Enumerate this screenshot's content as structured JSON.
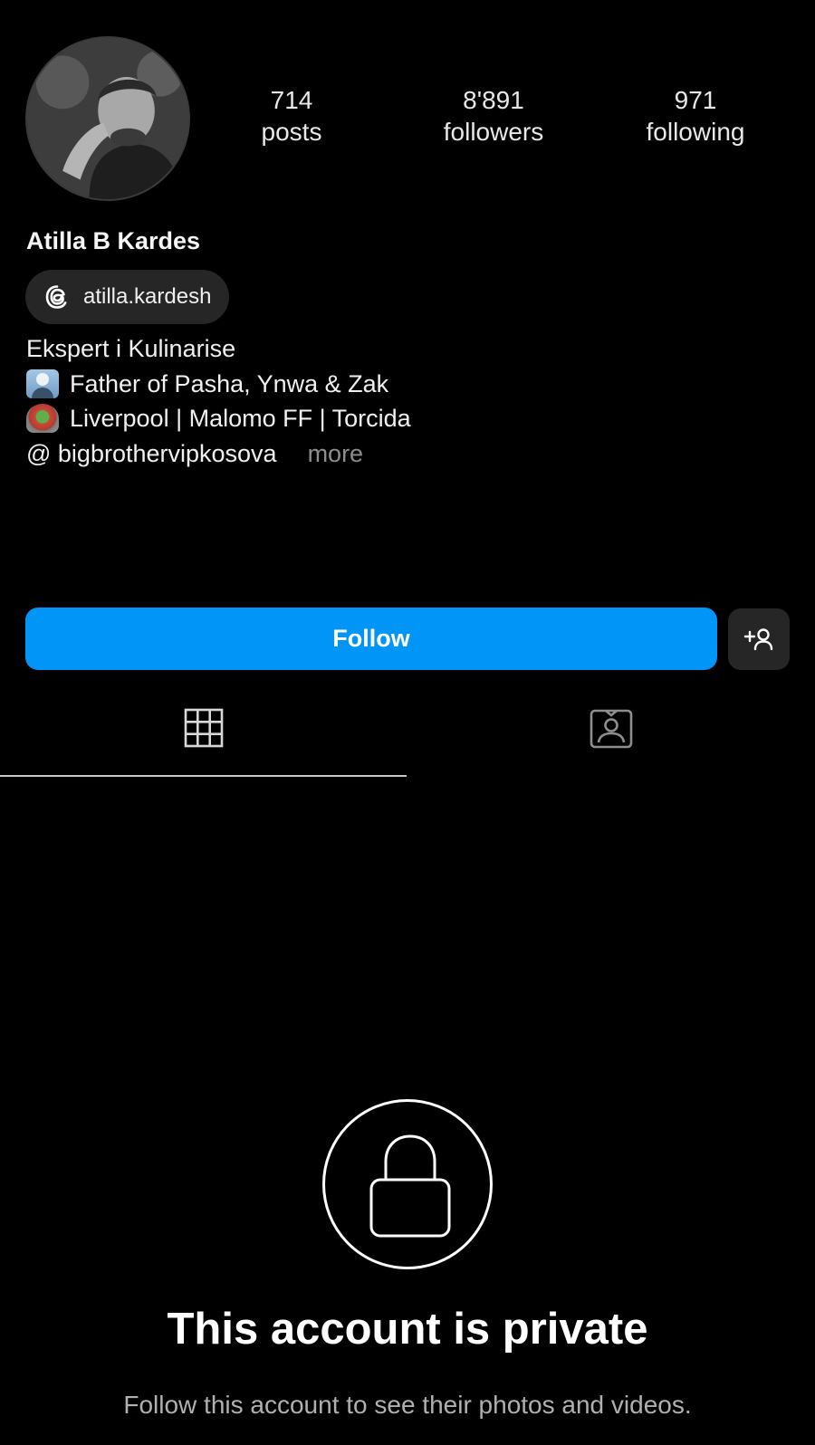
{
  "profile": {
    "name": "Atilla B Kardes",
    "threads_handle": "atilla.kardesh",
    "stats": {
      "posts_count": "714",
      "posts_label": "posts",
      "followers_count": "8'891",
      "followers_label": "followers",
      "following_count": "971",
      "following_label": "following"
    },
    "bio": {
      "line1": "Ekspert i Kulinarise",
      "line2": "Father of Pasha, Ynwa & Zak",
      "line3": "Liverpool | Malomo FF | Torcida",
      "line4": "@ bigbrothervipkosova",
      "more_label": "more"
    },
    "bio_emojis": [
      "person-emoji",
      "stadium-emoji"
    ]
  },
  "actions": {
    "follow_label": "Follow",
    "suggest_icon": "add-person-icon"
  },
  "tabs": [
    {
      "icon": "grid-icon",
      "active": true
    },
    {
      "icon": "tagged-icon",
      "active": false
    }
  ],
  "private_notice": {
    "title": "This account is private",
    "subtitle": "Follow this account to see their photos and videos.",
    "icon": "lock-icon"
  },
  "colors": {
    "background": "#000000",
    "accent": "#0095f6",
    "secondary_button": "#262626",
    "muted_text": "#8e8e8e"
  }
}
